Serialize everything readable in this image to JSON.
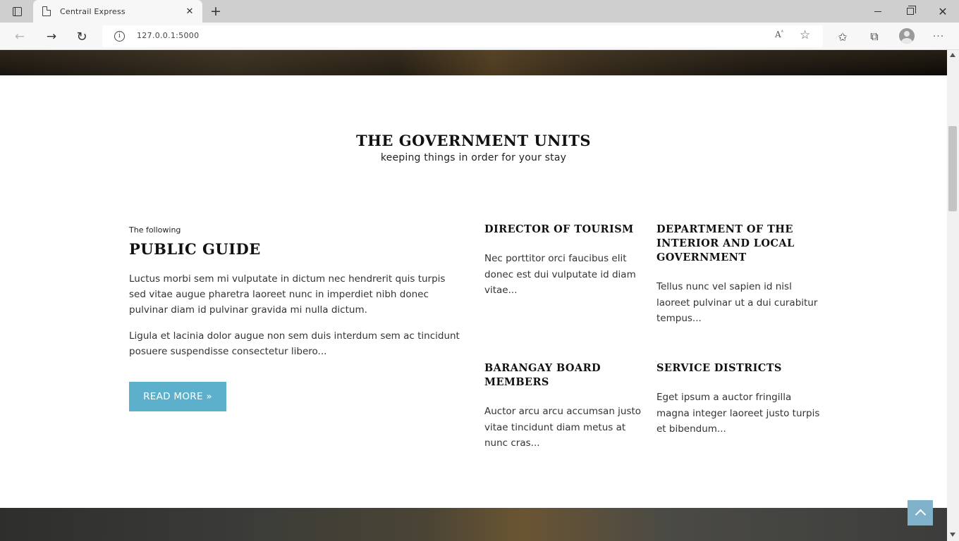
{
  "browser": {
    "tab_title": "Centrail Express",
    "tab_close": "✕",
    "new_tab": "+",
    "url": "127.0.0.1:5000",
    "read_aloud": "Aᴬ",
    "more": "···",
    "icons": [
      "tab-actions-icon",
      "page-icon",
      "back-arrow-icon",
      "forward-arrow-icon",
      "reload-icon",
      "info-icon",
      "read-aloud-icon",
      "add-favorite-icon",
      "favorites-icon",
      "collections-icon",
      "profile-icon",
      "more-icon",
      "minimize-icon",
      "maximize-icon",
      "close-icon"
    ]
  },
  "page": {
    "section_title": "THE GOVERNMENT UNITS",
    "section_subtitle": "keeping things in order for your stay",
    "guide": {
      "kicker": "The following",
      "title": "PUBLIC GUIDE",
      "paragraph1": "Luctus morbi sem mi vulputate in dictum nec hendrerit quis turpis sed vitae augue pharetra laoreet nunc in imperdiet nibh donec pulvinar diam id pulvinar gravida mi nulla dictum.",
      "paragraph2": "Ligula et lacinia dolor augue non sem duis interdum sem ac tincidunt posuere suspendisse consectetur libero...",
      "button_label": "READ MORE »"
    },
    "units": [
      {
        "title": "DIRECTOR OF TOURISM",
        "text": "Nec porttitor orci faucibus elit donec est dui vulputate id diam vitae..."
      },
      {
        "title": "DEPARTMENT OF THE INTERIOR AND LOCAL GOVERNMENT",
        "text": "Tellus nunc vel sapien id nisl laoreet pulvinar ut a dui curabitur tempus..."
      },
      {
        "title": "BARANGAY BOARD MEMBERS",
        "text": "Auctor arcu arcu accumsan justo vitae tincidunt diam metus at nunc cras..."
      },
      {
        "title": "SERVICE DISTRICTS",
        "text": "Eget ipsum a auctor fringilla magna integer laoreet justo turpis et bibendum..."
      }
    ]
  },
  "colors": {
    "button": "#5cb0cc",
    "back_to_top": "#7fb1cb"
  }
}
